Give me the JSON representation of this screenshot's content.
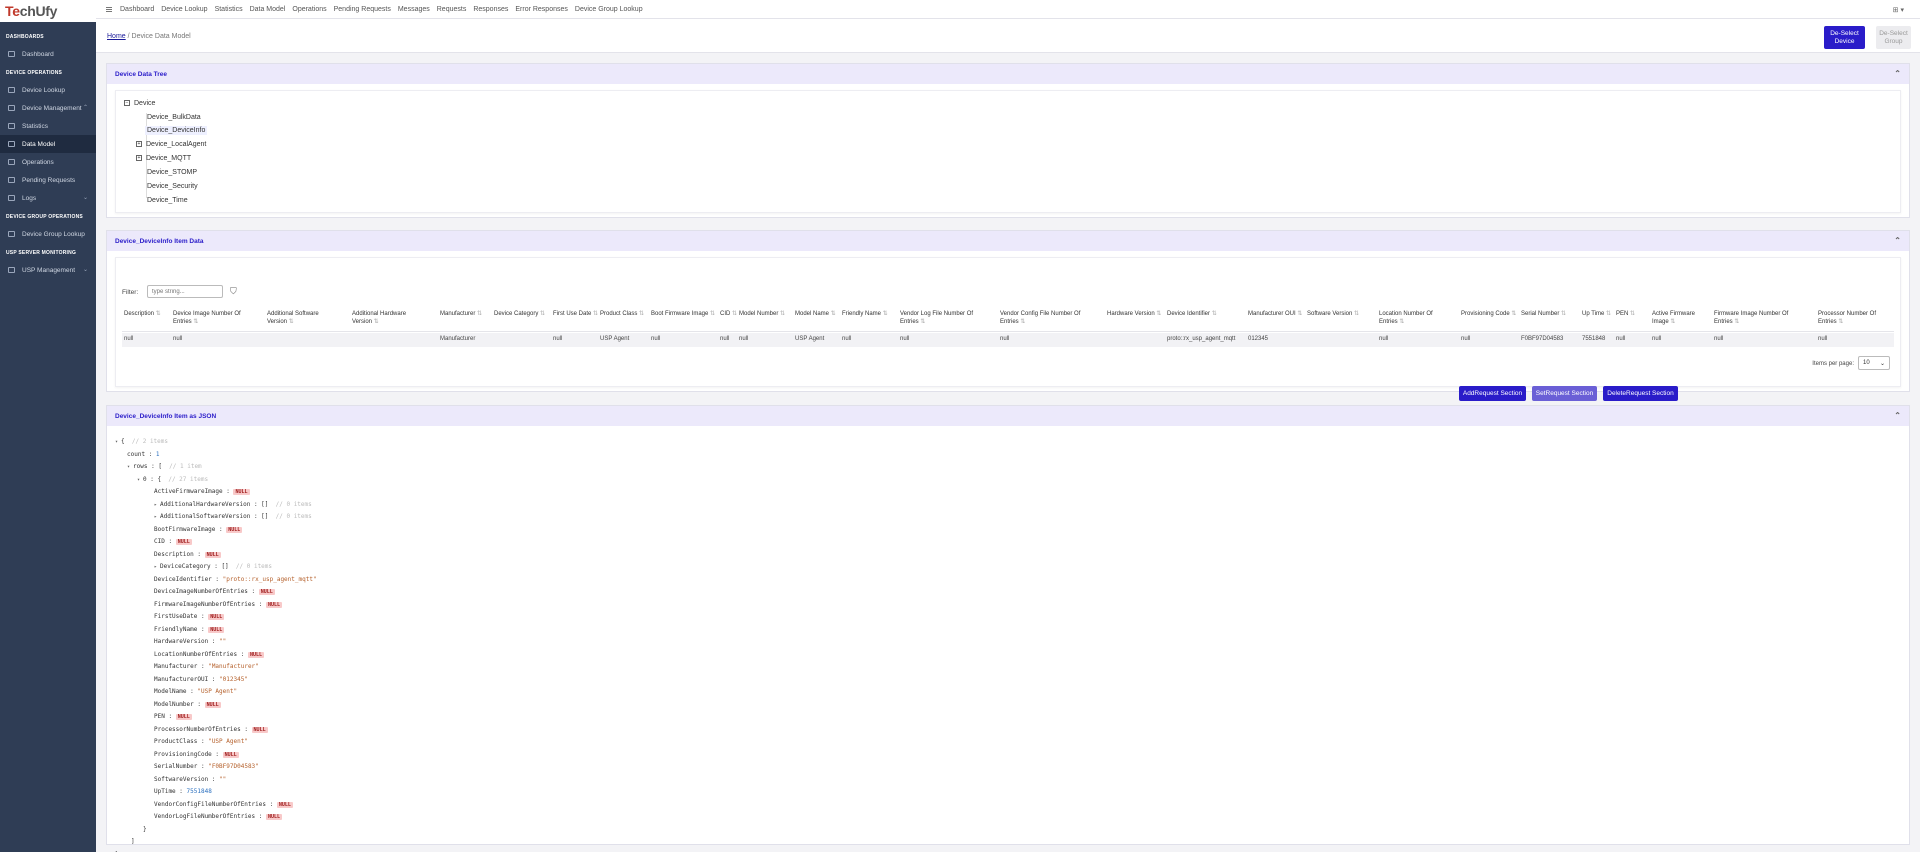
{
  "brand": {
    "logo_a": "Te",
    "logo_b": "chUfy"
  },
  "sidebar": {
    "sections": {
      "dashboards": "DASHBOARDS",
      "device_ops": "DEVICE OPERATIONS",
      "group_ops": "DEVICE GROUP OPERATIONS",
      "usp": "USP SERVER MONITORING"
    },
    "items": {
      "dashboard": "Dashboard",
      "device_lookup": "Device Lookup",
      "device_management": "Device Management",
      "statistics": "Statistics",
      "data_model": "Data Model",
      "operations": "Operations",
      "pending": "Pending Requests",
      "logs": "Logs",
      "group_lookup": "Device Group Lookup",
      "usp_management": "USP Management"
    }
  },
  "topnav": {
    "dashboard": "Dashboard",
    "device_lookup": "Device Lookup",
    "statistics": "Statistics",
    "data_model": "Data Model",
    "operations": "Operations",
    "pending": "Pending Requests",
    "messages": "Messages",
    "requests": "Requests",
    "responses": "Responses",
    "errors": "Error Responses",
    "group_lookup": "Device Group Lookup"
  },
  "breadcrumb": {
    "home": "Home",
    "sep": "/",
    "current": "Device Data Model"
  },
  "header_buttons": {
    "deselect_device_1": "De-Select",
    "deselect_device_2": "Device",
    "deselect_group_1": "De-Select",
    "deselect_group_2": "Group"
  },
  "tree_panel": {
    "title": "Device Data Tree",
    "root": "Device",
    "nodes": [
      "Device_BulkData",
      "Device_DeviceInfo",
      "Device_LocalAgent",
      "Device_MQTT",
      "Device_STOMP",
      "Device_Security",
      "Device_Time"
    ]
  },
  "item_panel": {
    "title": "Device_DeviceInfo Item Data",
    "filter_label": "Filter:",
    "filter_placeholder": "type string...",
    "columns": [
      [
        "Description",
        ""
      ],
      [
        "Device Image Number Of",
        "Entries"
      ],
      [
        "Additional Software",
        "Version"
      ],
      [
        "Additional Hardware",
        "Version"
      ],
      [
        "Manufacturer",
        ""
      ],
      [
        "Device Category",
        ""
      ],
      [
        "First Use Date",
        ""
      ],
      [
        "Product Class",
        ""
      ],
      [
        "Boot Firmware Image",
        ""
      ],
      [
        "CID",
        ""
      ],
      [
        "Model Number",
        ""
      ],
      [
        "Model Name",
        ""
      ],
      [
        "Friendly Name",
        ""
      ],
      [
        "Vendor Log File Number Of",
        "Entries"
      ],
      [
        "Vendor Config File Number Of",
        "Entries"
      ],
      [
        "Hardware Version",
        ""
      ],
      [
        "Device Identifier",
        ""
      ],
      [
        "Manufacturer OUI",
        ""
      ],
      [
        "Software Version",
        ""
      ],
      [
        "Location Number Of",
        "Entries"
      ],
      [
        "Provisioning Code",
        ""
      ],
      [
        "Serial Number",
        ""
      ],
      [
        "Up Time",
        ""
      ],
      [
        "PEN",
        ""
      ],
      [
        "Active Firmware",
        "Image"
      ],
      [
        "Firmware Image Number Of",
        "Entries"
      ],
      [
        "Processor Number Of",
        "Entries"
      ]
    ],
    "row": [
      "null",
      "null",
      "",
      "",
      "Manufacturer",
      "",
      "null",
      "USP Agent",
      "null",
      "null",
      "null",
      "USP Agent",
      "null",
      "null",
      "null",
      "",
      "proto::rx_usp_agent_mqtt",
      "012345",
      "",
      "null",
      "null",
      "F0BF97D04583",
      "7551848",
      "null",
      "null",
      "null",
      "null"
    ],
    "items_per_page_label": "Items per page:",
    "items_per_page": "10",
    "add_btn": "AddRequest Section",
    "set_btn": "SetRequest Section",
    "delete_btn": "DeleteRequest Section"
  },
  "json_panel": {
    "title": "Device_DeviceInfo Item as JSON",
    "lines": [
      {
        "t": "{",
        "c": "2 items",
        "tri": "▾"
      },
      {
        "k": "count",
        "v": "1",
        "type": "num"
      },
      {
        "k": "rows",
        "t": ": [",
        "c": "1 item",
        "tri": "▾"
      },
      {
        "k": "0",
        "t": ": {",
        "c": "27 items",
        "tri": "▾"
      },
      {
        "k": "ActiveFirmwareImage",
        "v": "NULL",
        "type": "null"
      },
      {
        "k": "AdditionalHardwareVersion",
        "t": ": []",
        "c": "0 items",
        "tri": "▸"
      },
      {
        "k": "AdditionalSoftwareVersion",
        "t": ": []",
        "c": "0 items",
        "tri": "▸"
      },
      {
        "k": "BootFirmwareImage",
        "v": "NULL",
        "type": "null"
      },
      {
        "k": "CID",
        "v": "NULL",
        "type": "null"
      },
      {
        "k": "Description",
        "v": "NULL",
        "type": "null"
      },
      {
        "k": "DeviceCategory",
        "t": ": []",
        "c": "0 items",
        "tri": "▸"
      },
      {
        "k": "DeviceIdentifier",
        "v": "\"proto::rx_usp_agent_mqtt\"",
        "type": "str"
      },
      {
        "k": "DeviceImageNumberOfEntries",
        "v": "NULL",
        "type": "null"
      },
      {
        "k": "FirmwareImageNumberOfEntries",
        "v": "NULL",
        "type": "null"
      },
      {
        "k": "FirstUseDate",
        "v": "NULL",
        "type": "null"
      },
      {
        "k": "FriendlyName",
        "v": "NULL",
        "type": "null"
      },
      {
        "k": "HardwareVersion",
        "v": "\"\"",
        "type": "str"
      },
      {
        "k": "LocationNumberOfEntries",
        "v": "NULL",
        "type": "null"
      },
      {
        "k": "Manufacturer",
        "v": "\"Manufacturer\"",
        "type": "str"
      },
      {
        "k": "ManufacturerOUI",
        "v": "\"012345\"",
        "type": "str"
      },
      {
        "k": "ModelName",
        "v": "\"USP Agent\"",
        "type": "str"
      },
      {
        "k": "ModelNumber",
        "v": "NULL",
        "type": "null"
      },
      {
        "k": "PEN",
        "v": "NULL",
        "type": "null"
      },
      {
        "k": "ProcessorNumberOfEntries",
        "v": "NULL",
        "type": "null"
      },
      {
        "k": "ProductClass",
        "v": "\"USP Agent\"",
        "type": "str"
      },
      {
        "k": "ProvisioningCode",
        "v": "NULL",
        "type": "null"
      },
      {
        "k": "SerialNumber",
        "v": "\"F0BF97D04583\"",
        "type": "str"
      },
      {
        "k": "SoftwareVersion",
        "v": "\"\"",
        "type": "str"
      },
      {
        "k": "UpTime",
        "v": "7551848",
        "type": "num"
      },
      {
        "k": "VendorConfigFileNumberOfEntries",
        "v": "NULL",
        "type": "null"
      },
      {
        "k": "VendorLogFileNumberOfEntries",
        "v": "NULL",
        "type": "null"
      },
      {
        "t": "}"
      },
      {
        "t": "]"
      },
      {
        "t": "}"
      }
    ]
  },
  "colors": {
    "accent": "#2a1cc9",
    "sidebar": "#2f3d55",
    "panel_head": "#ece9fb",
    "null_bg": "#f8c9c9"
  }
}
